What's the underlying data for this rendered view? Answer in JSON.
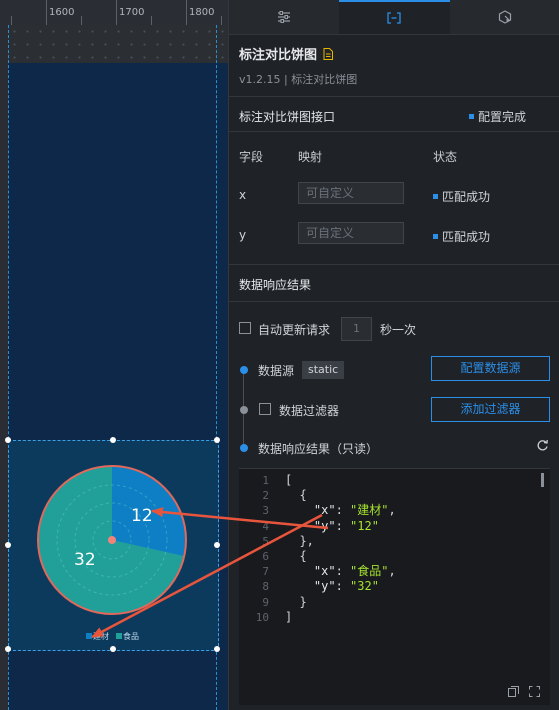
{
  "ruler": {
    "labels": [
      "1600",
      "1700",
      "1800"
    ]
  },
  "chart": {
    "labels": {
      "slice1_value": "12",
      "slice2_value": "32"
    },
    "legend": [
      {
        "name": "建材",
        "color": "#0e7fc4"
      },
      {
        "name": "食品",
        "color": "#21a09a"
      }
    ],
    "colors": {
      "slice1": "#0e7fc4",
      "slice2": "#21a09a",
      "ring": "#e0695b",
      "center": "#f2837a"
    }
  },
  "annotation": {
    "arrow_color": "#e8553d"
  },
  "panel": {
    "tabs": [
      {
        "icon": "sliders-icon",
        "active": false
      },
      {
        "icon": "data-bracket-icon",
        "active": true
      },
      {
        "icon": "interaction-icon",
        "active": false
      }
    ],
    "component": {
      "title": "标注对比饼图",
      "subtitle": "v1.2.15 | 标注对比饼图"
    },
    "interface": {
      "title": "标注对比饼图接口",
      "status": "配置完成",
      "headers": {
        "field": "字段",
        "mapping": "映射",
        "status": "状态"
      },
      "fields": [
        {
          "name": "x",
          "placeholder": "可自定义",
          "status": "匹配成功"
        },
        {
          "name": "y",
          "placeholder": "可自定义",
          "status": "匹配成功"
        }
      ]
    },
    "response": {
      "title": "数据响应结果",
      "auto_update_label": "自动更新请求",
      "interval": "1",
      "interval_unit": "秒一次",
      "datasource_label": "数据源",
      "datasource_type": "static",
      "configure_button": "配置数据源",
      "filter_label": "数据过滤器",
      "add_filter_button": "添加过滤器",
      "result_label": "数据响应结果（只读）"
    },
    "editor": {
      "lines": [
        "1",
        "2",
        "3",
        "4",
        "5",
        "6",
        "7",
        "8",
        "9",
        "10"
      ],
      "data": [
        {
          "x": "建材",
          "y": "12"
        },
        {
          "x": "食品",
          "y": "32"
        }
      ]
    }
  },
  "accent": "#2b8fe8"
}
